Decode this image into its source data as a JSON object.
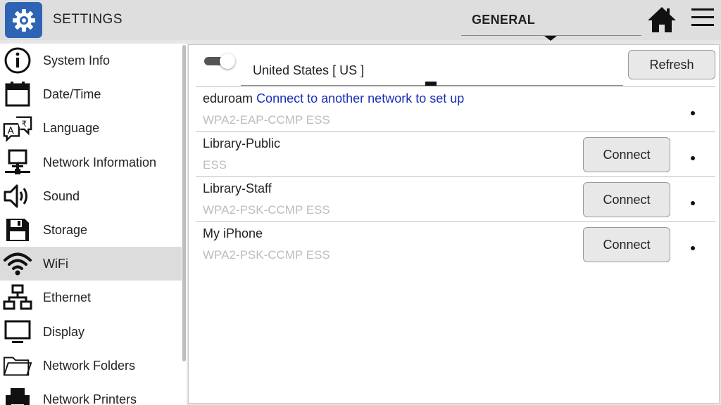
{
  "header": {
    "app_icon": "gear-icon",
    "title": "SETTINGS",
    "tab_label": "GENERAL",
    "home_icon": "home-icon",
    "menu_icon": "hamburger-menu-icon",
    "accent_color": "#2f64b5"
  },
  "sidebar": {
    "items": [
      {
        "label": "System Info",
        "icon": "info-icon"
      },
      {
        "label": "Date/Time",
        "icon": "calendar-icon"
      },
      {
        "label": "Language",
        "icon": "language-icon"
      },
      {
        "label": "Network Information",
        "icon": "network-computer-icon"
      },
      {
        "label": "Sound",
        "icon": "speaker-icon"
      },
      {
        "label": "Storage",
        "icon": "floppy-disk-icon"
      },
      {
        "label": "WiFi",
        "icon": "wifi-icon",
        "selected": true
      },
      {
        "label": "Ethernet",
        "icon": "ethernet-icon"
      },
      {
        "label": "Display",
        "icon": "monitor-icon"
      },
      {
        "label": "Network Folders",
        "icon": "folder-icon"
      },
      {
        "label": "Network Printers",
        "icon": "printer-icon"
      }
    ]
  },
  "wifi": {
    "enabled": true,
    "region": "United States [ US ]",
    "refresh_label": "Refresh",
    "networks": [
      {
        "name": "eduroam",
        "link": "Connect to another network to set up",
        "security": "WPA2-EAP-CCMP ESS",
        "button": ""
      },
      {
        "name": "Library-Public",
        "link": "",
        "security": "ESS",
        "button": "Connect"
      },
      {
        "name": "Library-Staff",
        "link": "",
        "security": "WPA2-PSK-CCMP ESS",
        "button": "Connect"
      },
      {
        "name": "My iPhone",
        "link": "",
        "security": "WPA2-PSK-CCMP ESS",
        "button": "Connect"
      }
    ]
  }
}
